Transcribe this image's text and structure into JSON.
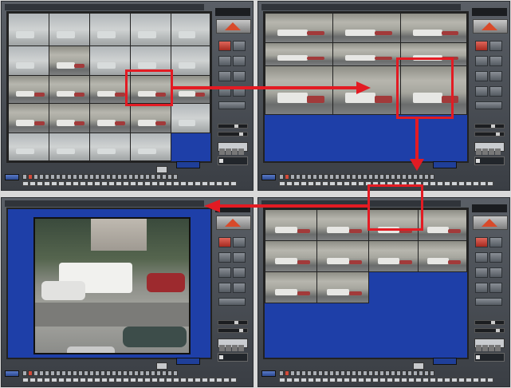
{
  "panels": [
    {
      "id": "p1",
      "layout": "16-split",
      "title": "",
      "clock": "",
      "date": ""
    },
    {
      "id": "p2",
      "layout": "6-split",
      "title": "",
      "clock": "",
      "date": ""
    },
    {
      "id": "p3",
      "layout": "single",
      "title": "",
      "clock": "",
      "date": ""
    },
    {
      "id": "p4",
      "layout": "8-split",
      "title": "",
      "clock": "",
      "date": ""
    }
  ],
  "colors": {
    "highlight": "#e31b23",
    "empty_view": "#1e3fa8",
    "frame": "#4a4e55"
  },
  "icons": [
    "logo-icon",
    "ptz-icon",
    "info-icon"
  ]
}
